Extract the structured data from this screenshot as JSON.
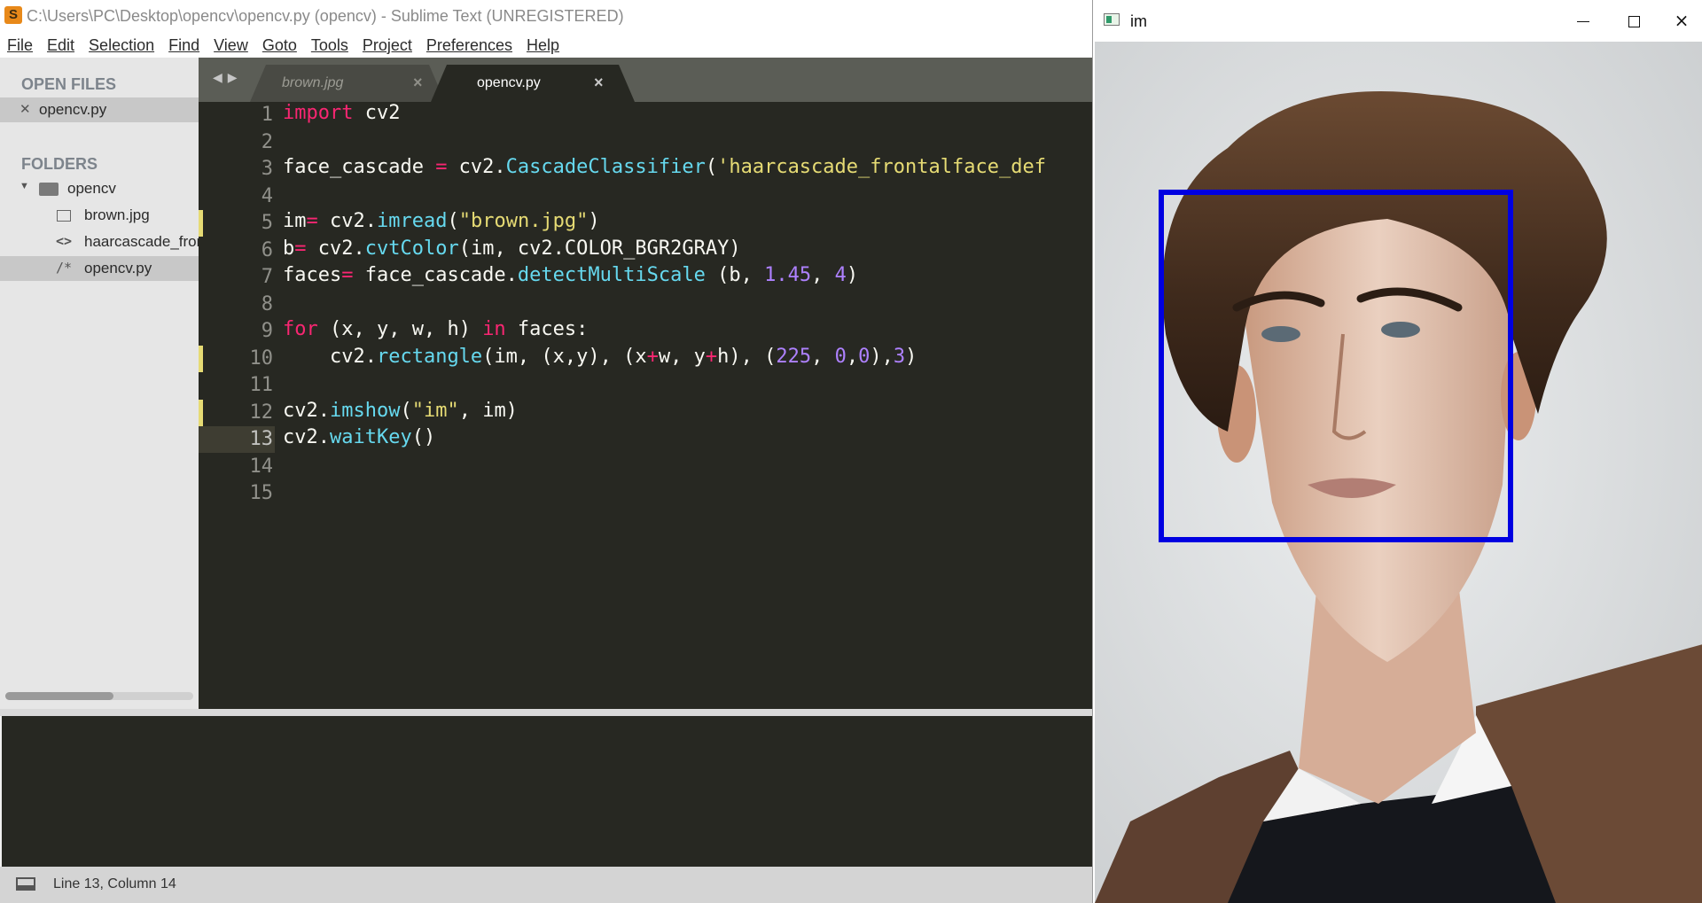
{
  "sublime": {
    "window_title": "C:\\Users\\PC\\Desktop\\opencv\\opencv.py (opencv) - Sublime Text (UNREGISTERED)",
    "menu": [
      "File",
      "Edit",
      "Selection",
      "Find",
      "View",
      "Goto",
      "Tools",
      "Project",
      "Preferences",
      "Help"
    ],
    "sidebar": {
      "open_files_heading": "OPEN FILES",
      "open_files": [
        {
          "name": "opencv.py",
          "icon": "close-icon"
        }
      ],
      "folders_heading": "FOLDERS",
      "folder": {
        "name": "opencv",
        "icon": "folder-icon",
        "expanded": true
      },
      "files": [
        {
          "name": "brown.jpg",
          "icon": "image-file-icon"
        },
        {
          "name": "haarcascade_frontalface_default.xml",
          "icon": "xml-file-icon"
        },
        {
          "name": "opencv.py",
          "icon": "python-file-icon",
          "selected": true
        }
      ]
    },
    "tabs": [
      {
        "label": "brown.jpg",
        "active": false,
        "close": "×"
      },
      {
        "label": "opencv.py",
        "active": true,
        "close": "×"
      }
    ],
    "editor": {
      "line_numbers": [
        "1",
        "2",
        "3",
        "4",
        "5",
        "6",
        "7",
        "8",
        "9",
        "10",
        "11",
        "12",
        "13",
        "14",
        "15"
      ],
      "modified_lines": [
        5,
        10,
        12
      ],
      "current_line": 13,
      "lines": [
        "import cv2",
        "",
        "face_cascade = cv2.CascadeClassifier('haarcascade_frontalface_def",
        "",
        "im= cv2.imread(\"brown.jpg\")",
        "b= cv2.cvtColor(im, cv2.COLOR_BGR2GRAY)",
        "faces= face_cascade.detectMultiScale (b, 1.45, 4)",
        "",
        "for (x, y, w, h) in faces:",
        "    cv2.rectangle(im, (x,y), (x+w, y+h), (225, 0,0),3)",
        "",
        "cv2.imshow(\"im\", im)",
        "cv2.waitKey()",
        "",
        ""
      ]
    },
    "status": "Line 13, Column 14",
    "colors": {
      "editor_bg": "#272822",
      "keyword": "#f92672",
      "function": "#66d9ef",
      "string": "#e6db74",
      "number": "#ae81ff",
      "text": "#f8f8f2"
    }
  },
  "image_window": {
    "title": "im",
    "controls": {
      "minimize": "minimize-icon",
      "maximize": "maximize-icon",
      "close": "×"
    },
    "detection_box_color": "#0000e1"
  }
}
